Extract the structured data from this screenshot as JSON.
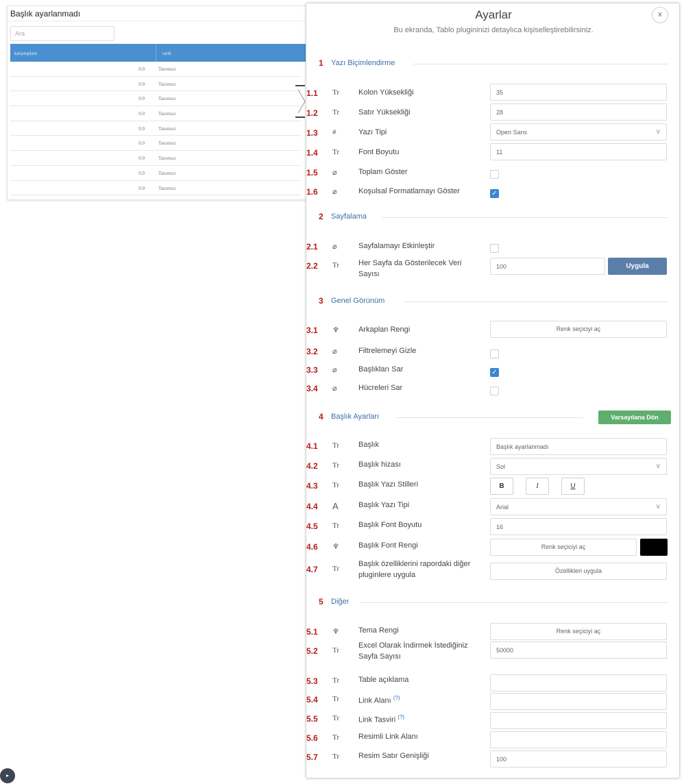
{
  "widget": {
    "title": "Başlık ayarlanmadı",
    "search_placeholder": "Ara",
    "columns": [
      "karşıtoplam",
      "tarih"
    ],
    "rows": [
      [
        "0.0",
        "Tanımsız"
      ],
      [
        "0.0",
        "Tanımsız"
      ],
      [
        "0.0",
        "Tanımsız"
      ],
      [
        "0.0",
        "Tanımsız"
      ],
      [
        "0.0",
        "Tanımsız"
      ],
      [
        "0.0",
        "Tanımsız"
      ],
      [
        "0.0",
        "Tanımsız"
      ],
      [
        "0.0",
        "Tanımsız"
      ],
      [
        "0.0",
        "Tanımsız"
      ]
    ]
  },
  "panel": {
    "title": "Ayarlar",
    "subtitle": "Bu ekranda, Tablo plugininizi detaylıca kişiselleştirebilirsiniz.",
    "close_label": "x",
    "accent_color": "#b71c1c",
    "link_color": "#3f6fa6",
    "sections": {
      "s1": {
        "num": "1",
        "title": "Yazı Biçimlendirme"
      },
      "s2": {
        "num": "2",
        "title": "Sayfalama"
      },
      "s3": {
        "num": "3",
        "title": "Genel Görünüm"
      },
      "s4": {
        "num": "4",
        "title": "Başlık Ayarları"
      },
      "s5": {
        "num": "5",
        "title": "Diğer"
      }
    },
    "items": {
      "r1_1": {
        "num": "1.1",
        "icon": "Tr",
        "label": "Kolon Yüksekliği",
        "value": "35"
      },
      "r1_2": {
        "num": "1.2",
        "icon": "Tr",
        "label": "Satır Yüksekliği",
        "value": "28"
      },
      "r1_3": {
        "num": "1.3",
        "icon": "#",
        "label": "Yazı Tipi",
        "value": "Open Sans"
      },
      "r1_4": {
        "num": "1.4",
        "icon": "Tr",
        "label": "Font Boyutu",
        "value": "11"
      },
      "r1_5": {
        "num": "1.5",
        "icon": "⌀",
        "label": "Toplam Göster",
        "checked": false
      },
      "r1_6": {
        "num": "1.6",
        "icon": "⌀",
        "label": "Koşulsal Formatlamayı Göster",
        "checked": true
      },
      "r2_1": {
        "num": "2.1",
        "icon": "⌀",
        "label": "Sayfalamayı Etkinleştir",
        "checked": false
      },
      "r2_2": {
        "num": "2.2",
        "icon": "Tr",
        "label": "Her Sayfa da Gösterilecek Veri Sayısı",
        "value": "100",
        "button": "Uygula"
      },
      "r3_1": {
        "num": "3.1",
        "icon": "♆",
        "label": "Arkaplan Rengi",
        "button": "Renk seçiciyi aç"
      },
      "r3_2": {
        "num": "3.2",
        "icon": "⌀",
        "label": "Filtrelemeyi Gizle",
        "checked": false
      },
      "r3_3": {
        "num": "3.3",
        "icon": "⌀",
        "label": "Başlıkları Sar",
        "checked": true
      },
      "r3_4": {
        "num": "3.4",
        "icon": "⌀",
        "label": "Hücreleri Sar",
        "checked": false
      },
      "s4_button": "Varsayılana Dön",
      "r4_1": {
        "num": "4.1",
        "icon": "Tr",
        "label": "Başlık",
        "value": "Başlık ayarlanmadı"
      },
      "r4_2": {
        "num": "4.2",
        "icon": "Tr",
        "label": "Başlık hizası",
        "value": "Sol"
      },
      "r4_3": {
        "num": "4.3",
        "icon": "Tr",
        "label": "Başlık Yazı Stilleri",
        "bold": "B",
        "italic": "I",
        "underline": "U"
      },
      "r4_4": {
        "num": "4.4",
        "icon": "A",
        "label": "Başlık Yazı Tipi",
        "value": "Arial"
      },
      "r4_5": {
        "num": "4.5",
        "icon": "Tr",
        "label": "Başlık Font Boyutu",
        "value": "16"
      },
      "r4_6": {
        "num": "4.6",
        "icon": "♆",
        "label": "Başlık Font Rengi",
        "button": "Renk seçiciyi aç",
        "color": "#000000"
      },
      "r4_7": {
        "num": "4.7",
        "icon": "Tr",
        "label": "Başlık özelliklerini rapordaki diğer pluginlere uygula",
        "button": "Özellikleri uygula"
      },
      "r5_1": {
        "num": "5.1",
        "icon": "♆",
        "label": "Tema Rengi",
        "button": "Renk seçiciyi aç"
      },
      "r5_2": {
        "num": "5.2",
        "icon": "Tr",
        "label": "Excel Olarak İndirmek İstediğiniz Sayfa Sayısı",
        "value": "50000"
      },
      "r5_3": {
        "num": "5.3",
        "icon": "Tr",
        "label": "Table açıklama",
        "value": ""
      },
      "r5_4": {
        "num": "5.4",
        "icon": "Tr",
        "label": "Link Alanı",
        "help": "(?)",
        "value": ""
      },
      "r5_5": {
        "num": "5.5",
        "icon": "Tr",
        "label": "Link Tasviri",
        "help": "(?)",
        "value": ""
      },
      "r5_6": {
        "num": "5.6",
        "icon": "Tr",
        "label": "Resimli Link Alanı",
        "value": ""
      },
      "r5_7": {
        "num": "5.7",
        "icon": "Tr",
        "label": "Resim Satır Genişliği",
        "value": "100"
      }
    }
  }
}
